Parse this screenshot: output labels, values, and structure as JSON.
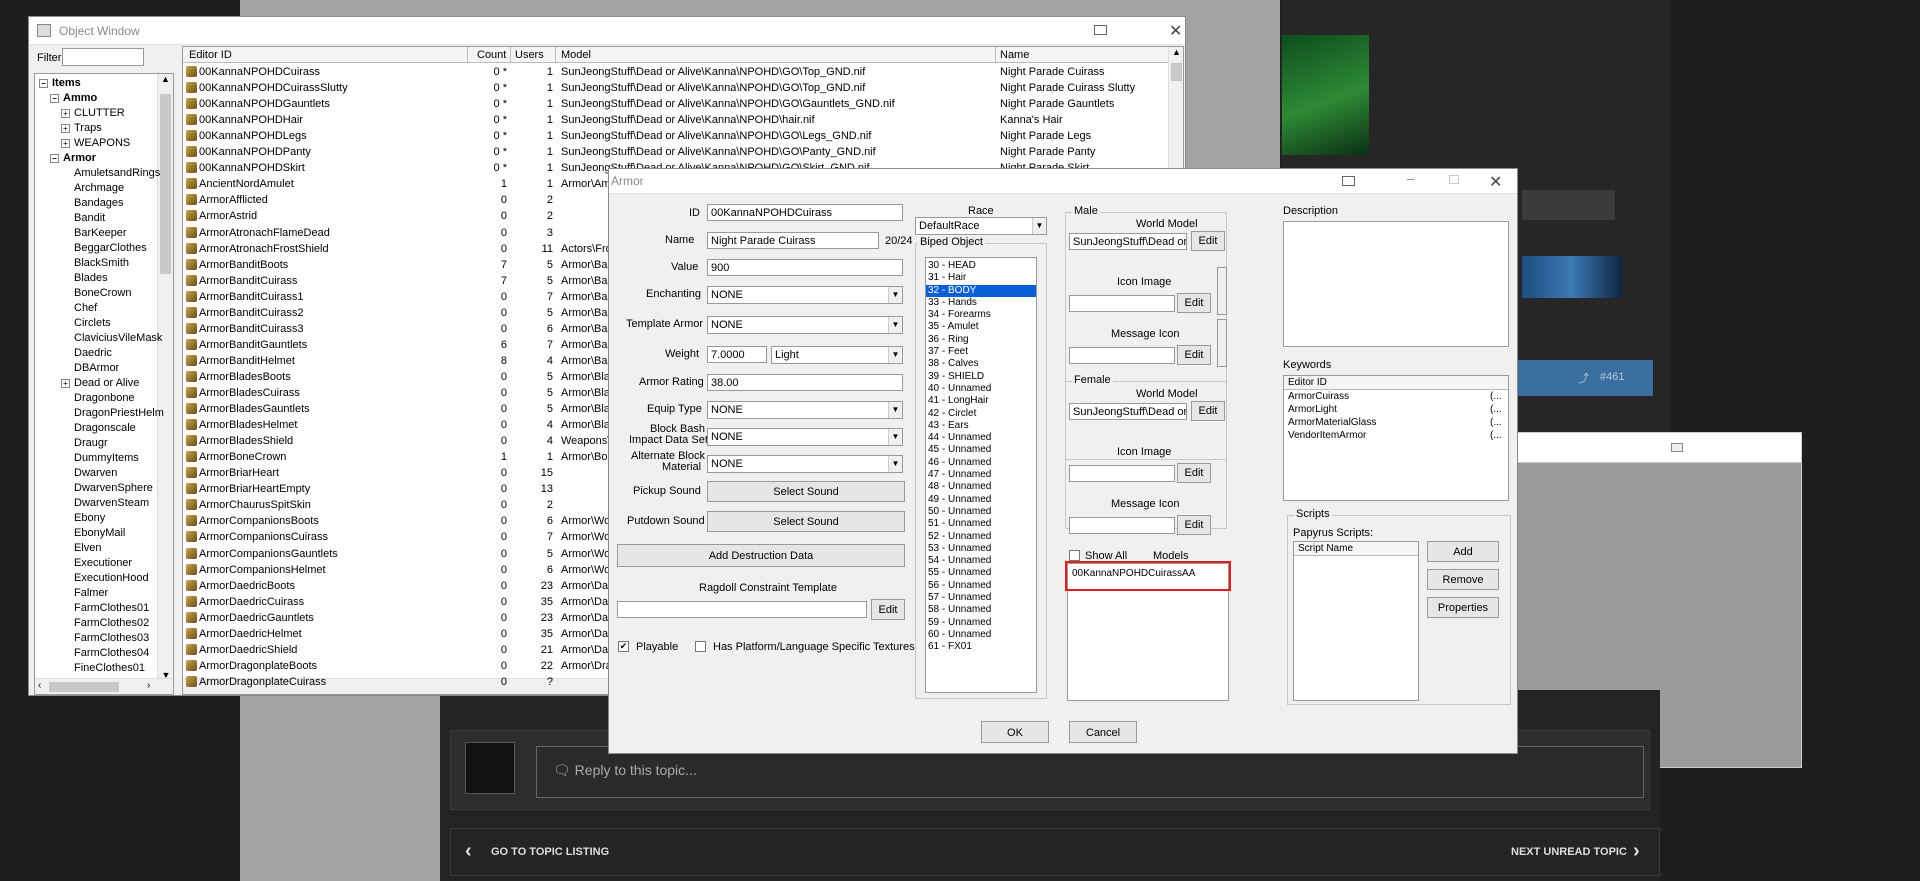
{
  "object_window": {
    "title": "Object Window",
    "filter_label": "Filter",
    "filter_value": "",
    "tree": [
      {
        "label": "Items",
        "level": 0,
        "box": "−",
        "bold": true
      },
      {
        "label": "Ammo",
        "level": 1,
        "box": "−",
        "bold": true
      },
      {
        "label": "CLUTTER",
        "level": 2,
        "box": "+"
      },
      {
        "label": "Traps",
        "level": 2,
        "box": "+"
      },
      {
        "label": "WEAPONS",
        "level": 2,
        "box": "+"
      },
      {
        "label": "Armor",
        "level": 1,
        "box": "−",
        "bold": true
      },
      {
        "label": "AmuletsandRings",
        "level": 2
      },
      {
        "label": "Archmage",
        "level": 2
      },
      {
        "label": "Bandages",
        "level": 2
      },
      {
        "label": "Bandit",
        "level": 2
      },
      {
        "label": "BarKeeper",
        "level": 2
      },
      {
        "label": "BeggarClothes",
        "level": 2
      },
      {
        "label": "BlackSmith",
        "level": 2
      },
      {
        "label": "Blades",
        "level": 2
      },
      {
        "label": "BoneCrown",
        "level": 2
      },
      {
        "label": "Chef",
        "level": 2
      },
      {
        "label": "Circlets",
        "level": 2
      },
      {
        "label": "ClaviciusVileMask",
        "level": 2
      },
      {
        "label": "Daedric",
        "level": 2
      },
      {
        "label": "DBArmor",
        "level": 2
      },
      {
        "label": "Dead or Alive",
        "level": 2,
        "box": "+"
      },
      {
        "label": "Dragonbone",
        "level": 2
      },
      {
        "label": "DragonPriestHelm",
        "level": 2
      },
      {
        "label": "Dragonscale",
        "level": 2
      },
      {
        "label": "Draugr",
        "level": 2
      },
      {
        "label": "DummyItems",
        "level": 2
      },
      {
        "label": "Dwarven",
        "level": 2
      },
      {
        "label": "DwarvenSphere",
        "level": 2
      },
      {
        "label": "DwarvenSteam",
        "level": 2
      },
      {
        "label": "Ebony",
        "level": 2
      },
      {
        "label": "EbonyMail",
        "level": 2
      },
      {
        "label": "Elven",
        "level": 2
      },
      {
        "label": "Executioner",
        "level": 2
      },
      {
        "label": "ExecutionHood",
        "level": 2
      },
      {
        "label": "Falmer",
        "level": 2
      },
      {
        "label": "FarmClothes01",
        "level": 2
      },
      {
        "label": "FarmClothes02",
        "level": 2
      },
      {
        "label": "FarmClothes03",
        "level": 2
      },
      {
        "label": "FarmClothes04",
        "level": 2
      },
      {
        "label": "FineClothes01",
        "level": 2
      }
    ],
    "columns": [
      "Editor ID",
      "Count",
      "Users",
      "Model",
      "Name"
    ],
    "rows": [
      [
        "00KannaNPOHDCuirass",
        "0 *",
        "1",
        "SunJeongStuff\\Dead or Alive\\Kanna\\NPOHD\\GO\\Top_GND.nif",
        "Night Parade Cuirass"
      ],
      [
        "00KannaNPOHDCuirassSlutty",
        "0 *",
        "1",
        "SunJeongStuff\\Dead or Alive\\Kanna\\NPOHD\\GO\\Top_GND.nif",
        "Night Parade Cuirass Slutty"
      ],
      [
        "00KannaNPOHDGauntlets",
        "0 *",
        "1",
        "SunJeongStuff\\Dead or Alive\\Kanna\\NPOHD\\GO\\Gauntlets_GND.nif",
        "Night Parade Gauntlets"
      ],
      [
        "00KannaNPOHDHair",
        "0 *",
        "1",
        "SunJeongStuff\\Dead or Alive\\Kanna\\NPOHD\\hair.nif",
        "Kanna's Hair"
      ],
      [
        "00KannaNPOHDLegs",
        "0 *",
        "1",
        "SunJeongStuff\\Dead or Alive\\Kanna\\NPOHD\\GO\\Legs_GND.nif",
        "Night Parade Legs"
      ],
      [
        "00KannaNPOHDPanty",
        "0 *",
        "1",
        "SunJeongStuff\\Dead or Alive\\Kanna\\NPOHD\\GO\\Panty_GND.nif",
        "Night Parade Panty"
      ],
      [
        "00KannaNPOHDSkirt",
        "0 *",
        "1",
        "SunJeongStuff\\Dead or Alive\\Kanna\\NPOHD\\GO\\Skirt_GND.nif",
        "Night Parade Skirt"
      ],
      [
        "AncientNordAmulet",
        "1",
        "1",
        "Armor\\Amuletsan",
        ""
      ],
      [
        "ArmorAfflicted",
        "0",
        "2",
        "",
        ""
      ],
      [
        "ArmorAstrid",
        "0",
        "2",
        "",
        ""
      ],
      [
        "ArmorAtronachFlameDead",
        "0",
        "3",
        "",
        ""
      ],
      [
        "ArmorAtronachFrostShield",
        "0",
        "11",
        "Actors\\FrostAtron",
        ""
      ],
      [
        "ArmorBanditBoots",
        "7",
        "5",
        "Armor\\Bandit\\bo",
        ""
      ],
      [
        "ArmorBanditCuirass",
        "7",
        "5",
        "Armor\\Bandit\\Cu",
        ""
      ],
      [
        "ArmorBanditCuirass1",
        "0",
        "7",
        "Armor\\Bandit\\ba",
        ""
      ],
      [
        "ArmorBanditCuirass2",
        "0",
        "5",
        "Armor\\Bandit\\ba",
        ""
      ],
      [
        "ArmorBanditCuirass3",
        "0",
        "6",
        "Armor\\Bandit\\ba",
        ""
      ],
      [
        "ArmorBanditGauntlets",
        "6",
        "7",
        "Armor\\Bandit\\ga",
        ""
      ],
      [
        "ArmorBanditHelmet",
        "8",
        "4",
        "Armor\\Bandit\\He",
        ""
      ],
      [
        "ArmorBladesBoots",
        "0",
        "5",
        "Armor\\Blades\\Bo",
        ""
      ],
      [
        "ArmorBladesCuirass",
        "0",
        "5",
        "Armor\\Blades\\Cu",
        ""
      ],
      [
        "ArmorBladesGauntlets",
        "0",
        "5",
        "Armor\\Blades\\Ga",
        ""
      ],
      [
        "ArmorBladesHelmet",
        "0",
        "4",
        "Armor\\Blades\\He",
        ""
      ],
      [
        "ArmorBladesShield",
        "0",
        "4",
        "Weapons\\Blades",
        ""
      ],
      [
        "ArmorBoneCrown",
        "1",
        "1",
        "Armor\\BoneCrow",
        ""
      ],
      [
        "ArmorBriarHeart",
        "0",
        "15",
        "",
        ""
      ],
      [
        "ArmorBriarHeartEmpty",
        "0",
        "13",
        "",
        ""
      ],
      [
        "ArmorChaurusSpitSkin",
        "0",
        "2",
        "",
        ""
      ],
      [
        "ArmorCompanionsBoots",
        "0",
        "6",
        "Armor\\Wolf\\Boot",
        ""
      ],
      [
        "ArmorCompanionsCuirass",
        "0",
        "7",
        "Armor\\Wolf\\Body",
        ""
      ],
      [
        "ArmorCompanionsGauntlets",
        "0",
        "5",
        "Armor\\Wolf\\Glov",
        ""
      ],
      [
        "ArmorCompanionsHelmet",
        "0",
        "6",
        "Armor\\Wolf\\Hat_",
        ""
      ],
      [
        "ArmorDaedricBoots",
        "0",
        "23",
        "Armor\\Daedric\\D",
        ""
      ],
      [
        "ArmorDaedricCuirass",
        "0",
        "35",
        "Armor\\Daedric\\D",
        ""
      ],
      [
        "ArmorDaedricGauntlets",
        "0",
        "23",
        "Armor\\Daedric\\D",
        ""
      ],
      [
        "ArmorDaedricHelmet",
        "0",
        "35",
        "Armor\\Daedric\\D",
        ""
      ],
      [
        "ArmorDaedricShield",
        "0",
        "21",
        "Armor\\Daedric\\D",
        ""
      ],
      [
        "ArmorDragonplateBoots",
        "0",
        "22",
        "Armor\\Dragonbo",
        ""
      ],
      [
        "ArmorDragonplateCuirass",
        "0",
        "?",
        "",
        ""
      ]
    ]
  },
  "armor_dialog": {
    "title": "Armor",
    "id_label": "ID",
    "id_value": "00KannaNPOHDCuirass",
    "name_label": "Name",
    "name_value": "Night Parade Cuirass",
    "name_count": "20/24",
    "value_label": "Value",
    "value_value": "900",
    "enchanting_label": "Enchanting",
    "enchanting_value": "NONE",
    "template_label": "Template Armor",
    "template_value": "NONE",
    "weight_label": "Weight",
    "weight_value": "7.0000",
    "weight_class": "Light",
    "rating_label": "Armor Rating",
    "rating_value": "38.00",
    "equip_label": "Equip Type",
    "equip_value": "NONE",
    "block_label_1": "Block Bash",
    "block_label_2": "Impact Data Set",
    "block_value": "NONE",
    "alt_label_1": "Alternate Block",
    "alt_label_2": "Material",
    "alt_value": "NONE",
    "pickup_label": "Pickup Sound",
    "putdown_label": "Putdown Sound",
    "select_sound": "Select Sound",
    "add_destruction": "Add Destruction Data",
    "ragdoll_label": "Ragdoll Constraint Template",
    "edit": "Edit",
    "playable_label": "Playable",
    "playable_checked": "✔",
    "platform_label": "Has Platform/Language Specific Textures",
    "race_label": "Race",
    "race_value": "DefaultRace",
    "biped_label": "Biped Object",
    "biped_slots": [
      "30 - HEAD",
      "31 - Hair",
      "32 - BODY",
      "33 - Hands",
      "34 - Forearms",
      "35 - Amulet",
      "36 - Ring",
      "37 - Feet",
      "38 - Calves",
      "39 - SHIELD",
      "40 - Unnamed",
      "41 - LongHair",
      "42 - Circlet",
      "43 - Ears",
      "44 - Unnamed",
      "45 - Unnamed",
      "46 - Unnamed",
      "47 - Unnamed",
      "48 - Unnamed",
      "49 - Unnamed",
      "50 - Unnamed",
      "51 - Unnamed",
      "52 - Unnamed",
      "53 - Unnamed",
      "54 - Unnamed",
      "55 - Unnamed",
      "56 - Unnamed",
      "57 - Unnamed",
      "58 - Unnamed",
      "59 - Unnamed",
      "60 - Unnamed",
      "61 - FX01"
    ],
    "biped_selected": "32 - BODY",
    "male_label": "Male",
    "female_label": "Female",
    "world_model_label": "World Model",
    "male_world_model": "SunJeongStuff\\Dead or Alive\\Kanna",
    "female_world_model": "SunJeongStuff\\Dead or Alive\\Kanna",
    "icon_image_label": "Icon Image",
    "message_icon_label": "Message Icon",
    "show_all_label": "Show All",
    "models_label": "Models",
    "model_entry": "00KannaNPOHDCuirassAA",
    "description_label": "Description",
    "keywords_label": "Keywords",
    "keywords_header": "Editor ID",
    "keywords": [
      "ArmorCuirass",
      "ArmorLight",
      "ArmorMaterialGlass",
      "VendorItemArmor"
    ],
    "keyword_suffix": "(...",
    "scripts_label": "Scripts",
    "papyrus_label": "Papyrus Scripts:",
    "script_name_header": "Script Name",
    "add": "Add",
    "remove": "Remove",
    "properties": "Properties",
    "ok": "OK",
    "cancel": "Cancel"
  },
  "forum": {
    "reply_placeholder": "Reply to this topic...",
    "go_to_listing": "GO TO TOPIC LISTING",
    "next_unread": "NEXT UNREAD TOPIC",
    "post_number": "#461"
  }
}
